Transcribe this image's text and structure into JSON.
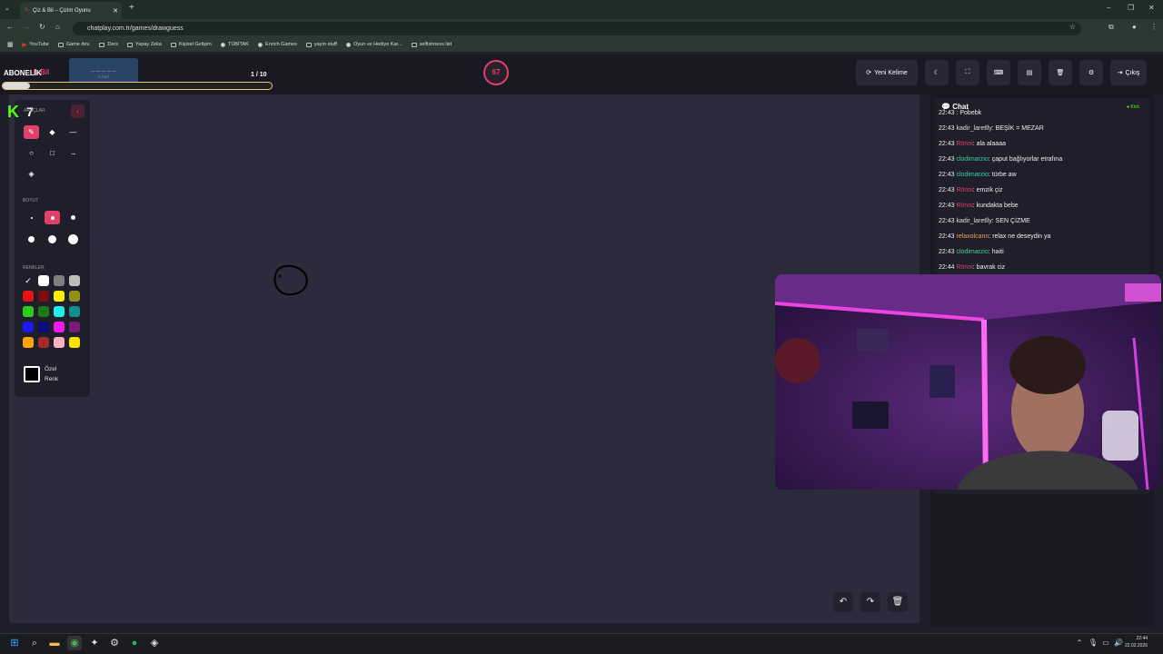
{
  "browser": {
    "tab_title": "Çiz & Bil – Çizim Oyunu",
    "url": "chatplay.com.tr/games/drawguess",
    "bookmarks": [
      "YouTube",
      "Game dev.",
      "Ders",
      "Yapay Zeka",
      "Kişisel Gelişim",
      "TÜBİTAK",
      "Enrich Games",
      "yayın stuff",
      "Oyun ve Hediye Kar...",
      "selfishness list"
    ]
  },
  "header": {
    "overlay_label": "ABONELİK",
    "brand_suffix": "& Bil",
    "word_mask": "_ _ _ _ _",
    "word_hint": "5 harf",
    "round": "1 / 10",
    "progress_fraction": 0.1,
    "timer": "67",
    "new_word": "Yeni Kelime",
    "exit": "Çıkış"
  },
  "tools": {
    "kick_number": "7",
    "section_tools": "ARAÇLAR",
    "section_size": "BOYUT",
    "section_colors": "RENKLER",
    "custom_color_line1": "Özel",
    "custom_color_line2": "Renk",
    "colors": [
      "#000000",
      "#ffffff",
      "#7f7f7f",
      "#bdbdbd",
      "#e81414",
      "#7a0f0f",
      "#ffee00",
      "#8f8f1a",
      "#2ecc1a",
      "#1a7a1a",
      "#1aeeee",
      "#138f8f",
      "#1a1aee",
      "#0c0c7a",
      "#ee1aee",
      "#7a1a7a",
      "#ffa500",
      "#a52a2a",
      "#ffb0c0",
      "#ffe000"
    ]
  },
  "chat": {
    "title": "Chat",
    "platform": "Kick",
    "messages": [
      {
        "time": "22:43",
        "user": "",
        "user_color": "#e0406a",
        "text": "Pobebk"
      },
      {
        "time": "22:43",
        "user": "kadir_laretlly",
        "user_color": "#dddddd",
        "text": "BEŞİK = MEZAR"
      },
      {
        "time": "22:43",
        "user": "Rönni",
        "user_color": "#e0406a",
        "text": "ala alaaaa"
      },
      {
        "time": "22:43",
        "user": "clodimarzio",
        "user_color": "#3ecfa0",
        "text": "çaput bağlıyorlar etrafına"
      },
      {
        "time": "22:43",
        "user": "clodimarzio",
        "user_color": "#3ecfa0",
        "text": "türbe aw"
      },
      {
        "time": "22:43",
        "user": "Rönni",
        "user_color": "#e0406a",
        "text": "emzik çiz"
      },
      {
        "time": "22:43",
        "user": "Rönni",
        "user_color": "#e0406a",
        "text": "kundakta bebe"
      },
      {
        "time": "22:43",
        "user": "kadir_laretlly",
        "user_color": "#dddddd",
        "text": "SEN ÇİZME"
      },
      {
        "time": "22:43",
        "user": "relaxolcann",
        "user_color": "#f0a050",
        "text": "relax ne deseydin ya"
      },
      {
        "time": "22:43",
        "user": "clodimarzio",
        "user_color": "#3ecfa0",
        "text": "haiti"
      },
      {
        "time": "22:44",
        "user": "Rönni",
        "user_color": "#e0406a",
        "text": "bayrak çiz"
      }
    ]
  },
  "taskbar": {
    "time": "22:44",
    "date": "22.02.2026"
  }
}
